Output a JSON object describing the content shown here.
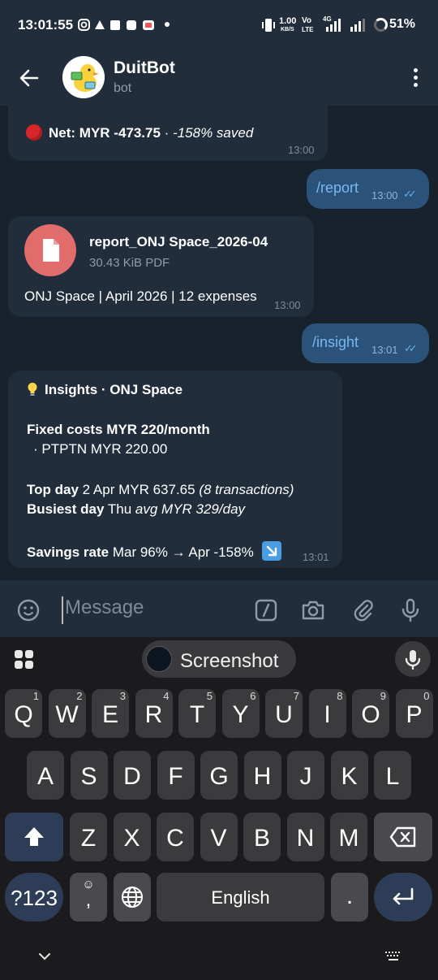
{
  "status_bar": {
    "time": "13:01:55",
    "data_rate": "1.00",
    "data_unit": "KB/S",
    "volte": "Vo",
    "lte": "LTE",
    "network": "4G",
    "battery": "51%"
  },
  "header": {
    "title": "DuitBot",
    "subtitle": "bot"
  },
  "messages": {
    "net": {
      "label": "Net: MYR -473.75",
      "separator": " · ",
      "saved": "-158% saved",
      "time": "13:00"
    },
    "report_cmd": {
      "text": "/report",
      "time": "13:00"
    },
    "file": {
      "name": "report_ONJ Space_2026-04",
      "size": "30.43 KiB PDF",
      "caption": "ONJ Space | April 2026 | 12 expenses",
      "time": "13:00"
    },
    "insight_cmd": {
      "text": "/insight",
      "time": "13:01"
    },
    "insights": {
      "title": "Insights · ONJ Space",
      "fixed_label": "Fixed costs",
      "fixed_value": "MYR 220/month",
      "fixed_item": "· PTPTN  MYR 220.00",
      "top_label": "Top day",
      "top_value": "2 Apr  MYR 637.65",
      "top_detail": "(8 transactions)",
      "busiest_label": "Busiest day",
      "busiest_day": "Thu",
      "busiest_detail": "avg MYR 329/day",
      "savings_label": "Savings rate",
      "savings_value": "Mar 96%  →  Apr -158%",
      "time": "13:01"
    }
  },
  "input": {
    "placeholder": "Message"
  },
  "keyboard": {
    "suggestion": "Screenshot",
    "row1": [
      {
        "k": "Q",
        "h": "1"
      },
      {
        "k": "W",
        "h": "2"
      },
      {
        "k": "E",
        "h": "3"
      },
      {
        "k": "R",
        "h": "4"
      },
      {
        "k": "T",
        "h": "5"
      },
      {
        "k": "Y",
        "h": "6"
      },
      {
        "k": "U",
        "h": "7"
      },
      {
        "k": "I",
        "h": "8"
      },
      {
        "k": "O",
        "h": "9"
      },
      {
        "k": "P",
        "h": "0"
      }
    ],
    "row2": [
      "A",
      "S",
      "D",
      "F",
      "G",
      "H",
      "J",
      "K",
      "L"
    ],
    "row3": [
      "Z",
      "X",
      "C",
      "V",
      "B",
      "N",
      "M"
    ],
    "symbols": "?123",
    "comma": ",",
    "space": "English",
    "period": "."
  },
  "colors": {
    "background": "#18222d",
    "header": "#212d3b",
    "incoming_bubble": "#212d3b",
    "outgoing_bubble": "#2b5278",
    "accent": "#79b8f3"
  }
}
